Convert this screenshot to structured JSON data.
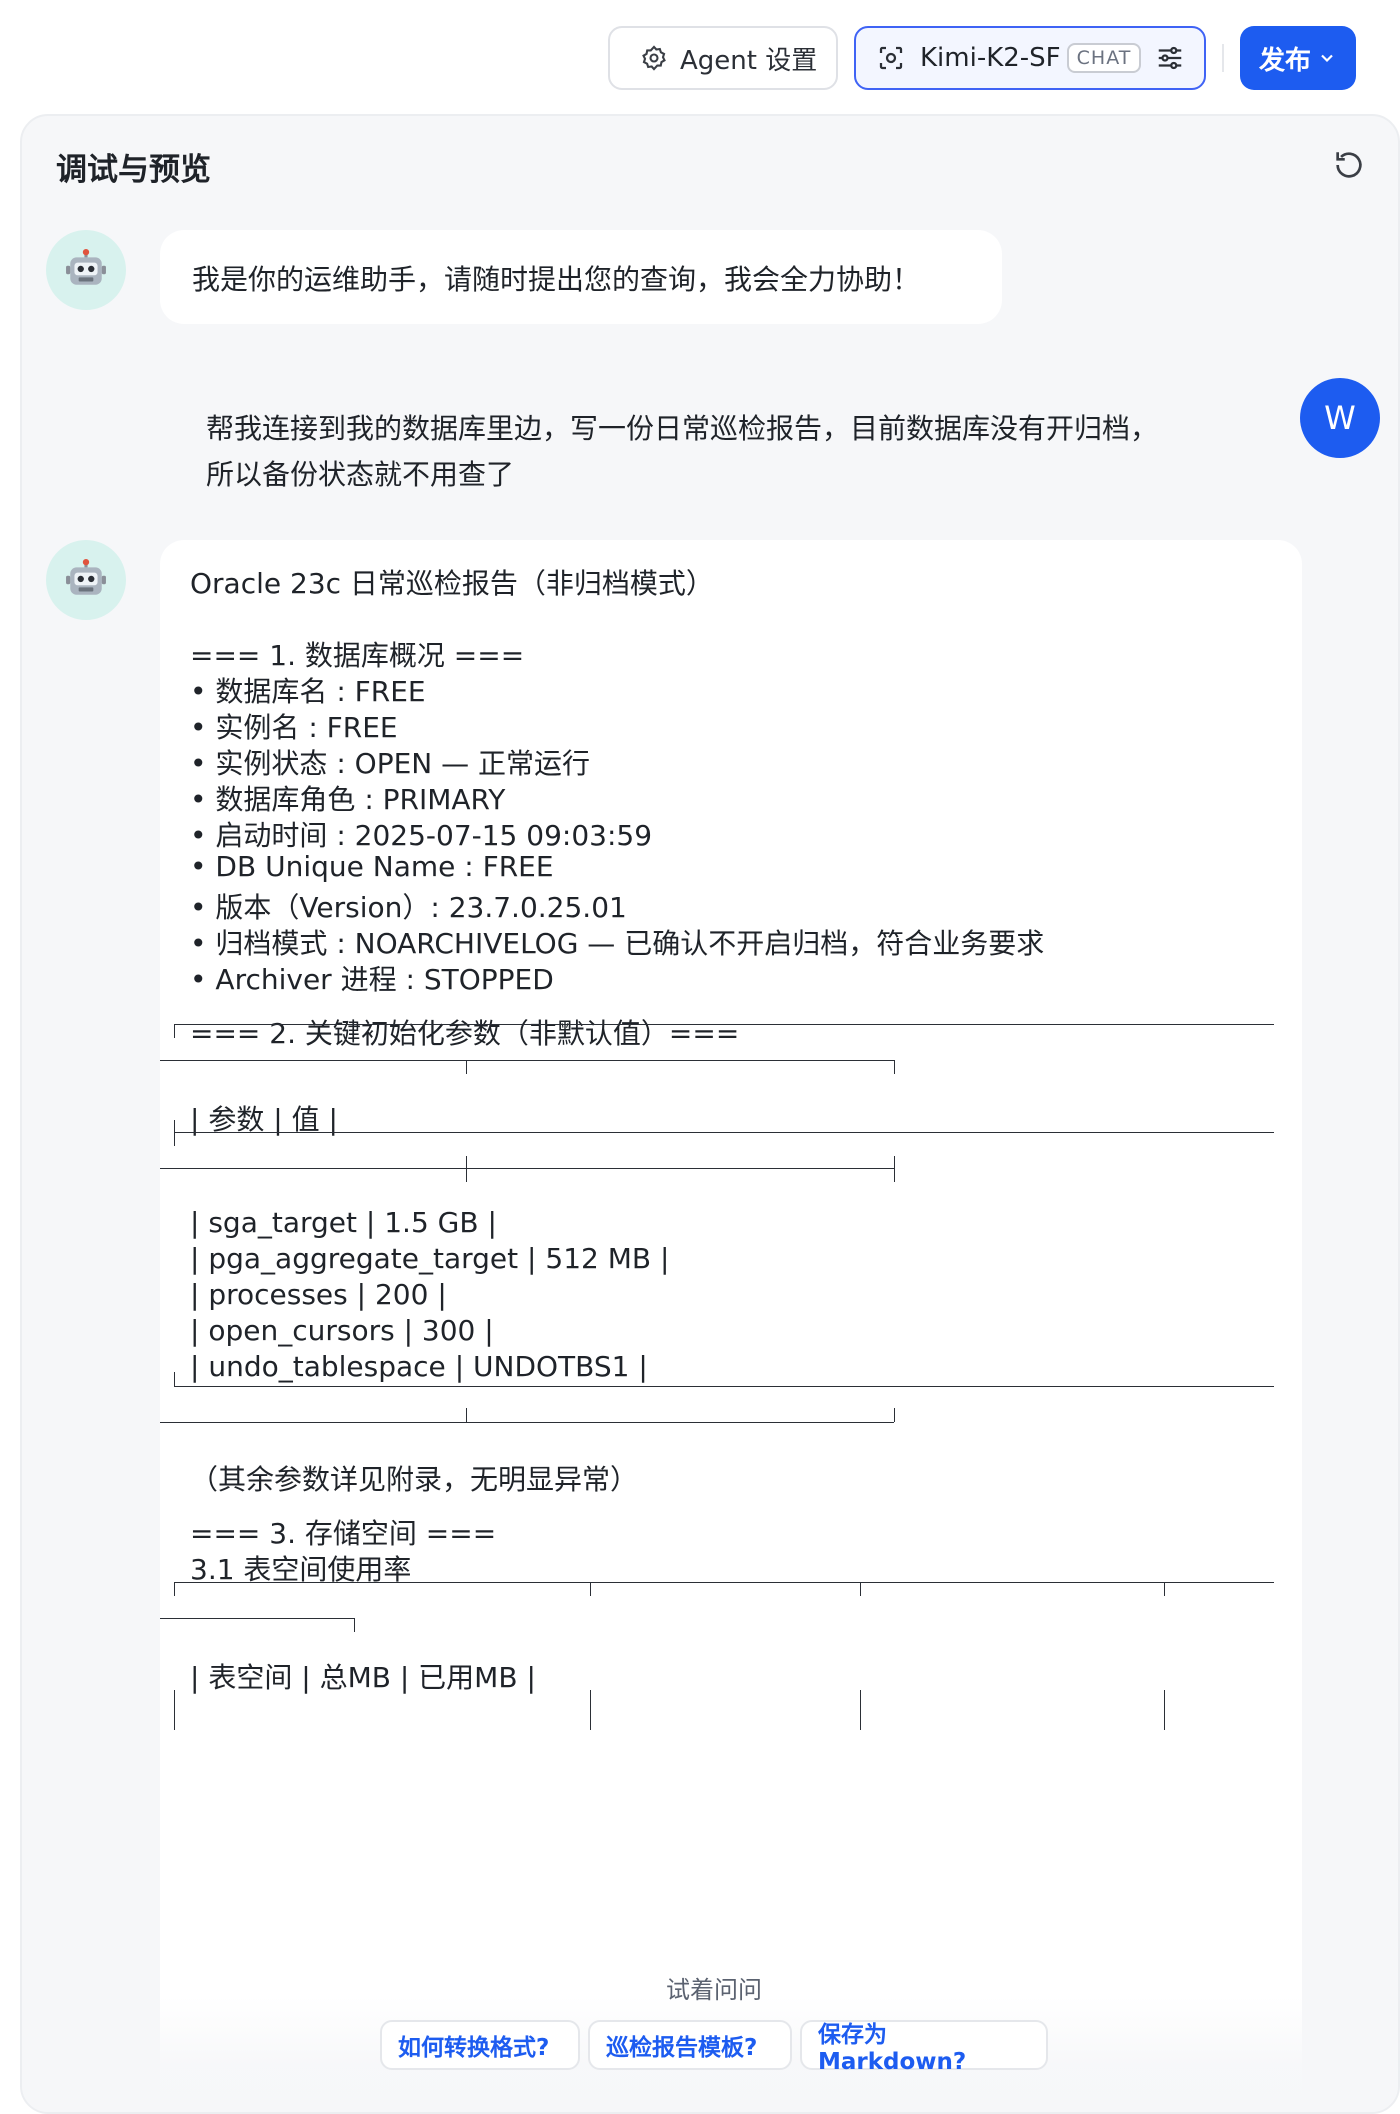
{
  "topbar": {
    "agent_settings_label": "Agent 设置",
    "model_name": "Kimi-K2-SF",
    "model_badge": "CHAT",
    "publish_label": "发布"
  },
  "panel": {
    "title": "调试与预览"
  },
  "messages": {
    "bot_greeting": "我是你的运维助手，请随时提出您的查询，我会全力协助！",
    "user_avatar": "W",
    "user_line1": "帮我连接到我的数据库里边，写一份日常巡检报告，目前数据库没有开归档，",
    "user_line2": "所以备份状态就不用查了"
  },
  "report": {
    "title": "Oracle 23c 日常巡检报告（非归档模式）",
    "s1_header": "=== 1. 数据库概况 ===",
    "s1_items": [
      "• 数据库名 : FREE",
      "• 实例名 : FREE",
      "• 实例状态 : OPEN — 正常运行",
      "• 数据库角色 : PRIMARY",
      "• 启动时间 : 2025-07-15 09:03:59",
      "• DB Unique Name : FREE",
      "• 版本（Version）: 23.7.0.25.01",
      "• 归档模式 : NOARCHIVELOG — 已确认不开启归档，符合业务要求",
      "• Archiver 进程 : STOPPED"
    ],
    "s2_header": "=== 2. 关键初始化参数（非默认值）===",
    "s2_table_header": "| 参数 | 值 |",
    "s2_rows": [
      "| sga_target | 1.5 GB |",
      "| pga_aggregate_target | 512 MB |",
      "| processes | 200 |",
      "| open_cursors | 300 |",
      "| undo_tablespace | UNDOTBS1 |"
    ],
    "s2_note": "（其余参数详见附录，无明显异常）",
    "s3_header": "=== 3. 存储空间 ===",
    "s3_sub": "3.1 表空间使用率",
    "s3_table_header": "| 表空间 | 总MB | 已用MB |"
  },
  "suggestions": {
    "label": "试着问问",
    "items": [
      "如何转换格式?",
      "巡检报告模板?",
      "保存为Markdown?"
    ]
  },
  "colors": {
    "accent": "#1d5cf0",
    "bot_avatar_bg": "#d8f2ee",
    "panel_bg": "#f6f7f9"
  }
}
